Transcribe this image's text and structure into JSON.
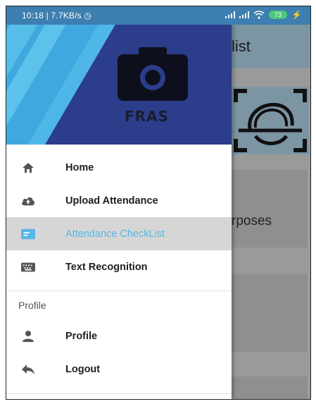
{
  "status_bar": {
    "time_speed": "10:18 | 7.7KB/s",
    "battery": "73"
  },
  "background": {
    "title_partial": "list",
    "card_text_partial": "rposes"
  },
  "drawer": {
    "logo_text": "FRAS",
    "items": [
      {
        "label": "Home",
        "icon": "home-icon"
      },
      {
        "label": "Upload Attendance",
        "icon": "cloud-upload-icon"
      },
      {
        "label": "Attendance CheckList",
        "icon": "list-card-icon",
        "active": true
      },
      {
        "label": "Text Recognition",
        "icon": "keyboard-icon"
      }
    ],
    "section_title": "Profile",
    "profile_items": [
      {
        "label": "Profile",
        "icon": "person-icon"
      },
      {
        "label": "Logout",
        "icon": "reply-arrow-icon"
      }
    ]
  },
  "colors": {
    "header_blue": "#2c3d8c",
    "header_cyan": "#3fa8de",
    "active_text": "#55b8e6",
    "status_bar": "#3d7fb0"
  }
}
